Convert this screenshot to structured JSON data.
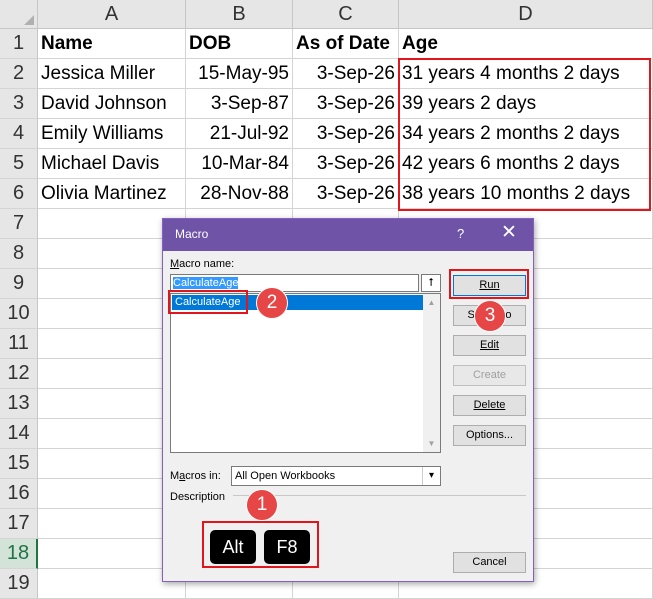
{
  "columns": [
    "A",
    "B",
    "C",
    "D"
  ],
  "rows": [
    "1",
    "2",
    "3",
    "4",
    "5",
    "6",
    "7",
    "8",
    "9",
    "10",
    "11",
    "12",
    "13",
    "14",
    "15",
    "16",
    "17",
    "18",
    "19"
  ],
  "headers": {
    "name": "Name",
    "dob": "DOB",
    "as_of": "As of Date",
    "age": "Age"
  },
  "people": [
    {
      "name": "Jessica Miller",
      "dob": "15-May-95",
      "as_of": "3-Sep-26",
      "age": "31 years 4 months 2 days"
    },
    {
      "name": "David Johnson",
      "dob": "3-Sep-87",
      "as_of": "3-Sep-26",
      "age": "39 years 2 days"
    },
    {
      "name": "Emily Williams",
      "dob": "21-Jul-92",
      "as_of": "3-Sep-26",
      "age": "34 years 2 months 2 days"
    },
    {
      "name": "Michael Davis",
      "dob": "10-Mar-84",
      "as_of": "3-Sep-26",
      "age": "42 years 6 months 2 days"
    },
    {
      "name": "Olivia Martinez",
      "dob": "28-Nov-88",
      "as_of": "3-Sep-26",
      "age": "38 years 10 months 2 days"
    }
  ],
  "dialog": {
    "title": "Macro",
    "help": "?",
    "close": "✕",
    "macro_name_label_u": "M",
    "macro_name_label_rest": "acro name:",
    "macro_name_value": "CalculateAge",
    "up_button": "⭡",
    "list_items": [
      "CalculateAge"
    ],
    "buttons": {
      "run": "Run",
      "step_into": "Step Into",
      "edit": "Edit",
      "create": "Create",
      "delete": "Delete",
      "options": "Options...",
      "cancel": "Cancel"
    },
    "macros_in_label_pre": "M",
    "macros_in_label_u": "a",
    "macros_in_label_rest": "cros in:",
    "macros_in_value": "All Open Workbooks",
    "description_label": "Description",
    "keys": [
      "Alt",
      "F8"
    ]
  },
  "steps": [
    "1",
    "2",
    "3"
  ],
  "colors": {
    "highlight_red": "#e0161c",
    "badge": "#e64646",
    "titlebar": "#6e53a6",
    "selection": "#0078d7"
  }
}
